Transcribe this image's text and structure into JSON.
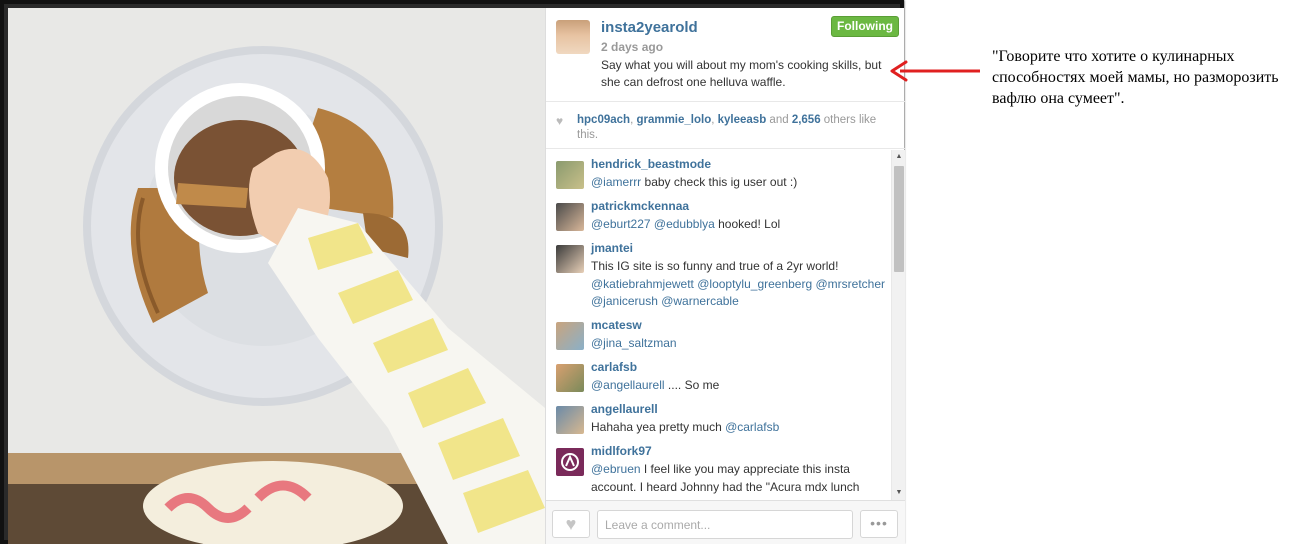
{
  "post": {
    "username": "insta2yearold",
    "time_ago": "2 days ago",
    "caption": "Say what you will about my mom's cooking skills, but she can defrost one helluva waffle.",
    "follow_label": "Following"
  },
  "likes": {
    "users": [
      "hpc09ach",
      "grammie_lolo",
      "kyleeasb"
    ],
    "sep1": ", ",
    "sep2": ", ",
    "and_text": " and ",
    "count_text": "2,656",
    "suffix": " others like this."
  },
  "comments": [
    {
      "user": "hendrick_beastmode",
      "mention": "@iamerrr",
      "text": " baby check this ig user out :)"
    },
    {
      "user": "patrickmckennaa",
      "mention": "@eburt227 @edubblya",
      "text": " hooked! Lol"
    },
    {
      "user": "jmantei",
      "text": "This IG site is so funny and true of a 2yr world! ",
      "mention": "@katiebrahmjewett @looptylu_greenberg @mrsretcher @janicerush @warnercable"
    },
    {
      "user": "mcatesw",
      "mention": "@jina_saltzman",
      "text": ""
    },
    {
      "user": "carlafsb",
      "mention": "@angellaurell",
      "text": " .... So me"
    },
    {
      "user": "angellaurell",
      "text": "Hahaha yea pretty much ",
      "mention": "@carlafsb"
    },
    {
      "user": "midlfork97",
      "mention": "@ebruen",
      "text": " I feel like you may appreciate this insta account. I heard Johnny had the \"Acura mdx lunch"
    }
  ],
  "footer": {
    "comment_placeholder": "Leave a comment...",
    "more_label": "•••",
    "like_icon": "♥"
  },
  "annotation": {
    "translation": "\"Говорите что хотите о кулинарных способностях моей мамы, но разморозить вафлю она сумеет\".",
    "arrow_color": "#e02020"
  },
  "colors": {
    "link": "#3f729b",
    "follow_green": "#6bb842"
  }
}
